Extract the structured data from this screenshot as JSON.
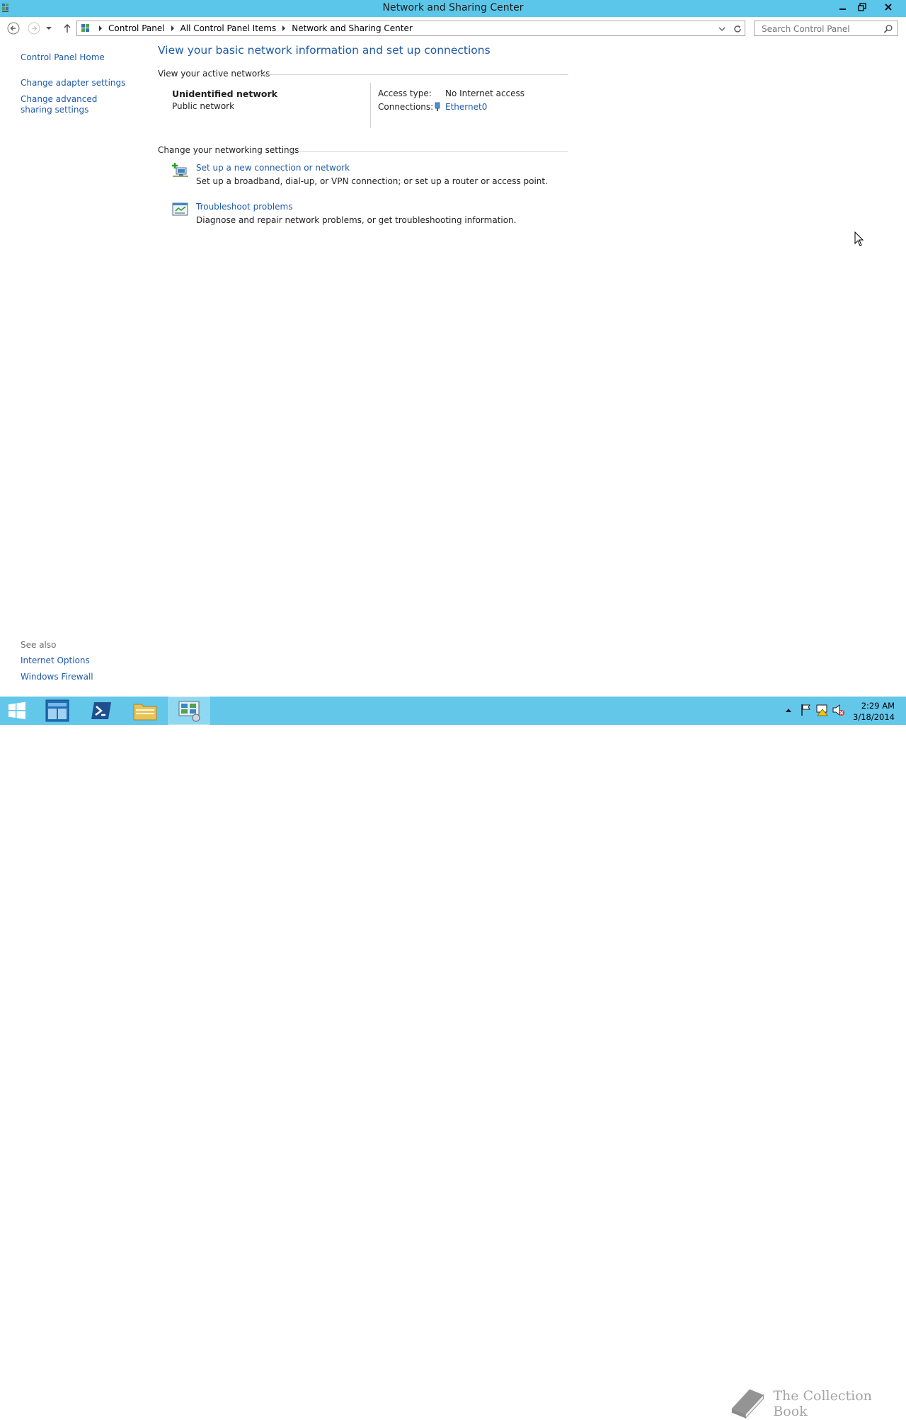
{
  "window": {
    "title": "Network and Sharing Center"
  },
  "address_bar": {
    "crumbs": [
      "Control Panel",
      "All Control Panel Items",
      "Network and Sharing Center"
    ]
  },
  "search": {
    "placeholder": "Search Control Panel"
  },
  "left_pane": {
    "home": "Control Panel Home",
    "links": [
      "Change adapter settings",
      "Change advanced sharing settings"
    ],
    "see_also_header": "See also",
    "see_also": [
      "Internet Options",
      "Windows Firewall"
    ]
  },
  "main": {
    "heading": "View your basic network information and set up connections",
    "active_networks_header": "View your active networks",
    "network": {
      "name": "Unidentified network",
      "type": "Public network",
      "access_type_label": "Access type:",
      "access_type_value": "No Internet access",
      "connections_label": "Connections:",
      "connection_name": "Ethernet0"
    },
    "change_settings_header": "Change your networking settings",
    "tasks": [
      {
        "label": "Set up a new connection or network",
        "description": "Set up a broadband, dial-up, or VPN connection; or set up a router or access point."
      },
      {
        "label": "Troubleshoot problems",
        "description": "Diagnose and repair network problems, or get troubleshooting information."
      }
    ]
  },
  "taskbar": {
    "clock_time": "2:29 AM",
    "clock_date": "3/18/2014",
    "watermark": "The Collection Book"
  },
  "colors": {
    "titlebar": "#5bc6e9",
    "taskbar": "#63c7ea",
    "link": "#1e5aa8"
  }
}
